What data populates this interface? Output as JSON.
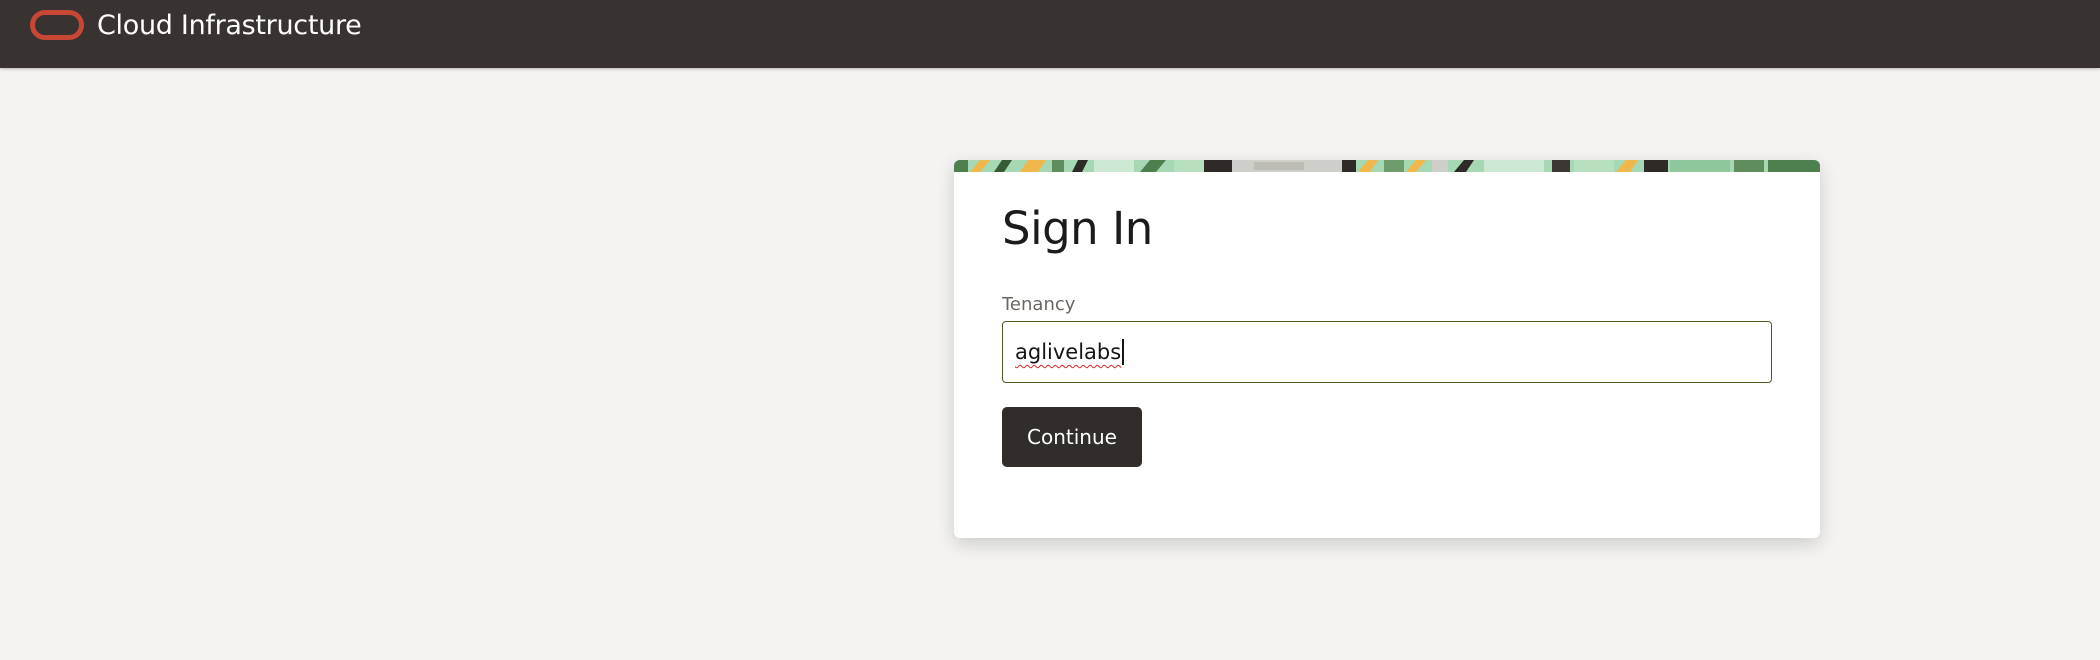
{
  "header": {
    "logo_icon": "oracle-logo-icon",
    "title": "Cloud Infrastructure"
  },
  "signin": {
    "heading": "Sign In",
    "tenancy_label": "Tenancy",
    "tenancy_value": "aglivelabs",
    "continue_label": "Continue"
  },
  "colors": {
    "header_bg": "#383330",
    "logo": "#c74634",
    "button_bg": "#312d2a",
    "input_border": "#4e5c24",
    "page_bg": "#f4f3f1"
  }
}
